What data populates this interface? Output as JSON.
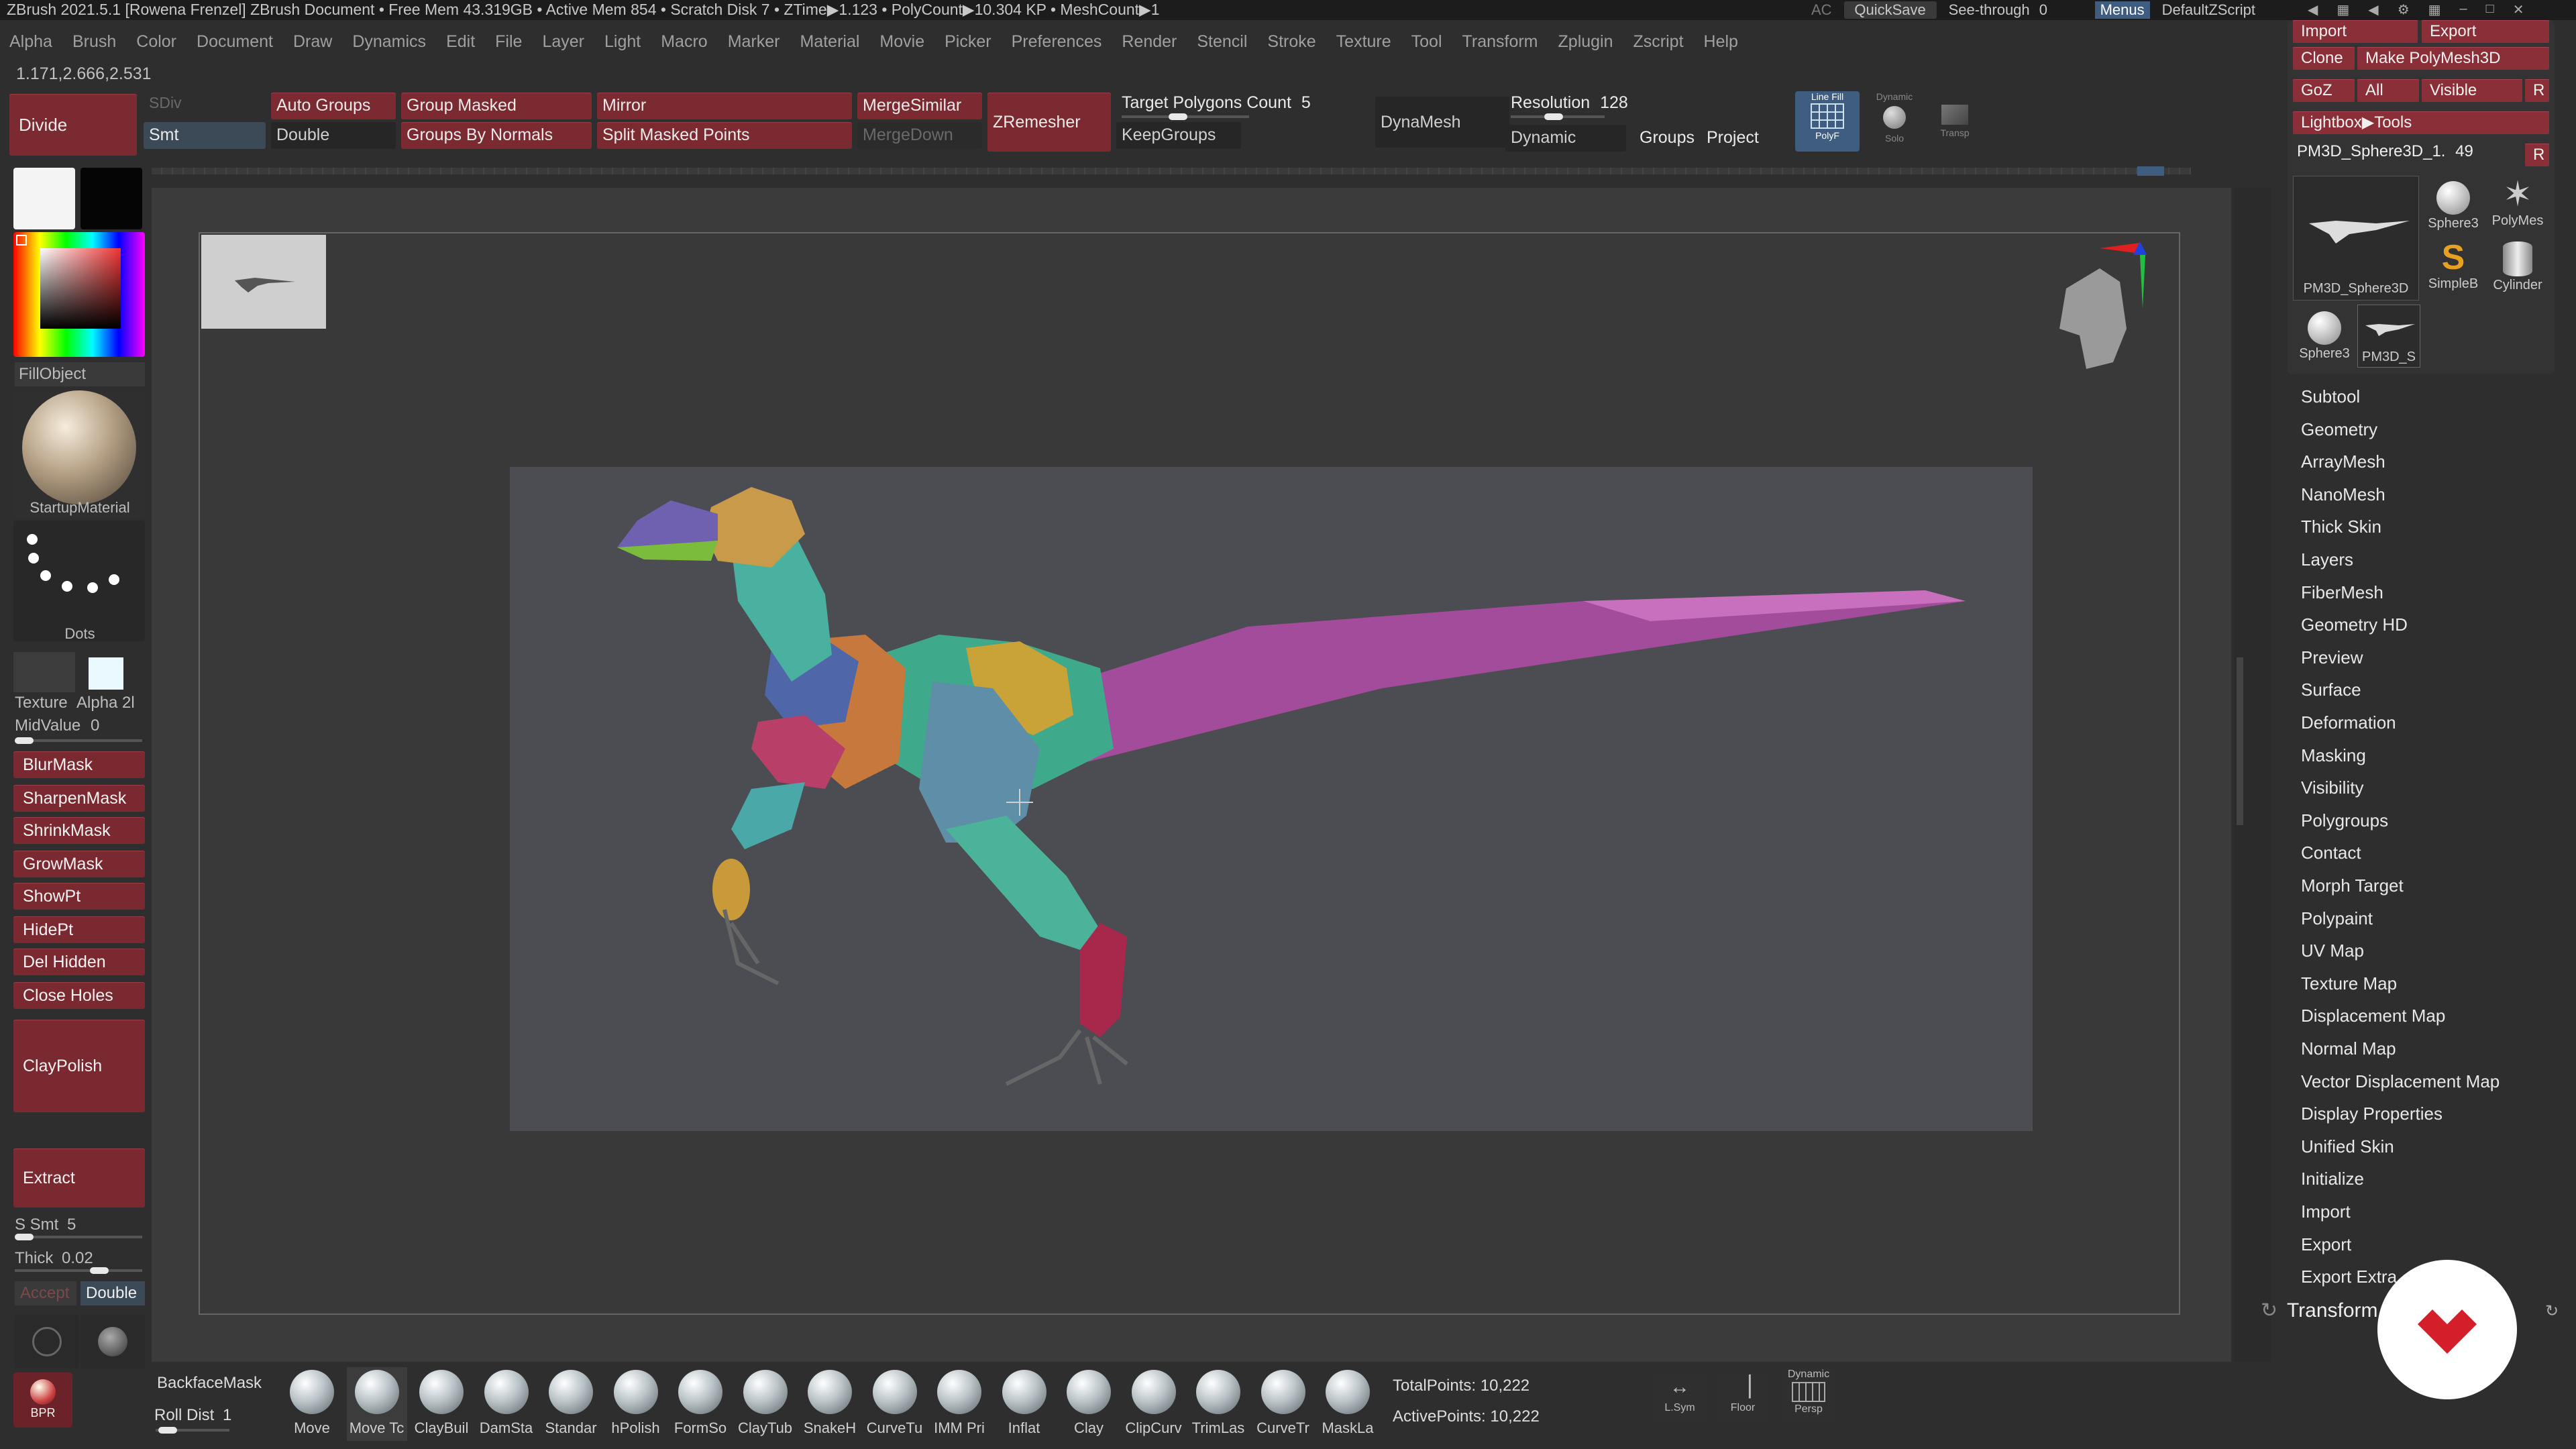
{
  "titlebar": {
    "text": "ZBrush 2021.5.1 [Rowena Frenzel]   ZBrush Document      • Free Mem 43.319GB • Active Mem 854 • Scratch Disk 7 •   ZTime▶1.123 • PolyCount▶10.304 KP • MeshCount▶1",
    "ac": "AC",
    "quicksave": "QuickSave",
    "seethrough": "See-through",
    "seethrough_value": "0",
    "menus": "Menus",
    "script": "DefaultZScript"
  },
  "menu": [
    "Alpha",
    "Brush",
    "Color",
    "Document",
    "Draw",
    "Dynamics",
    "Edit",
    "File",
    "Layer",
    "Light",
    "Macro",
    "Marker",
    "Material",
    "Movie",
    "Picker",
    "Preferences",
    "Render",
    "Stencil",
    "Stroke",
    "Texture",
    "Tool",
    "Transform",
    "Zplugin",
    "Zscript",
    "Help"
  ],
  "coord": "1.171,2.666,2.531",
  "toolbar": {
    "divide": "Divide",
    "sdiv": "SDiv",
    "smt": "Smt",
    "auto_groups": "Auto Groups",
    "double": "Double",
    "group_masked": "Group Masked",
    "groups_by_normals": "Groups By Normals",
    "mirror": "Mirror",
    "split_masked": "Split Masked Points",
    "merge_similar": "MergeSimilar",
    "merge_down": "MergeDown",
    "zremesher": "ZRemesher",
    "target_label": "Target Polygons Count",
    "target_value": "5",
    "keepgroups": "KeepGroups",
    "dynamesh": "DynaMesh",
    "resolution_label": "Resolution",
    "resolution_value": "128",
    "dynamic": "Dynamic",
    "groups": "Groups",
    "project": "Project",
    "linefill": "Line Fill",
    "polyf": "PolyF",
    "dynamic_small": "Dynamic",
    "solo": "Solo",
    "transp": "Transp"
  },
  "tool_palette": {
    "import": "Import",
    "export": "Export",
    "clone": "Clone",
    "make_polymesh": "Make PolyMesh3D",
    "goz": "GoZ",
    "all": "All",
    "visible": "Visible",
    "r": "R",
    "lightbox": "Lightbox▶Tools",
    "current_tool": "PM3D_Sphere3D_1.",
    "current_value": "49",
    "thumbs": [
      "PM3D_Sphere3D",
      "Sphere3",
      "PolyMes",
      "SimpleB",
      "Cylinder",
      "Sphere3",
      "PM3D_S"
    ]
  },
  "left": {
    "fillobject": "FillObject",
    "material": "StartupMaterial",
    "stroke": "Dots",
    "texture": "Texture",
    "alpha": "Alpha 2l",
    "midvalue_label": "MidValue",
    "midvalue": "0",
    "blurmask": "BlurMask",
    "sharpenmask": "SharpenMask",
    "shrinkmask": "ShrinkMask",
    "growmask": "GrowMask",
    "showpt": "ShowPt",
    "hidept": "HidePt",
    "delhidden": "Del Hidden",
    "closeholes": "Close Holes",
    "claypolish": "ClayPolish",
    "extract": "Extract",
    "ssmt_label": "S Smt",
    "ssmt": "5",
    "thick_label": "Thick",
    "thick": "0.02",
    "accept": "Accept",
    "double": "Double",
    "bpr": "BPR"
  },
  "right_list": [
    "Subtool",
    "Geometry",
    "ArrayMesh",
    "NanoMesh",
    "Thick Skin",
    "Layers",
    "FiberMesh",
    "Geometry HD",
    "Preview",
    "Surface",
    "Deformation",
    "Masking",
    "Visibility",
    "Polygroups",
    "Contact",
    "Morph Target",
    "Polypaint",
    "UV Map",
    "Texture Map",
    "Displacement Map",
    "Normal Map",
    "Vector Displacement Map",
    "Display Properties",
    "Unified Skin",
    "Initialize",
    "Import",
    "Export",
    "Export Extra"
  ],
  "transform_label": "Transform",
  "bottom": {
    "backface": "BackfaceMask",
    "rolldist_label": "Roll Dist",
    "rolldist": "1",
    "brushes": [
      "Move",
      "Move Tc",
      "ClayBuil",
      "DamSta",
      "Standar",
      "hPolish",
      "FormSo",
      "ClayTub",
      "SnakeH",
      "CurveTu",
      "IMM Pri",
      "Inflat",
      "Clay",
      "ClipCurv",
      "TrimLas",
      "CurveTr",
      "MaskLa"
    ],
    "total_label": "TotalPoints:",
    "total": "10,222",
    "active_label": "ActivePoints:",
    "active": "10,222",
    "lsym": "L.Sym",
    "floor": "Floor",
    "dynamic": "Dynamic",
    "persp": "Persp"
  },
  "colors": {
    "accent_red": "#7c2a31",
    "bg": "#2e2e2e",
    "viewport": "#4b4d52"
  }
}
